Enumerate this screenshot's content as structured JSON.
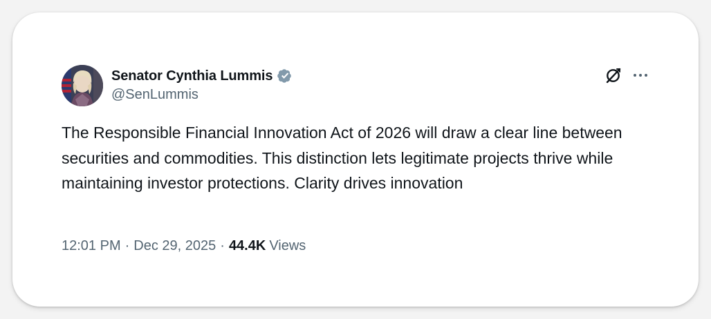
{
  "author": {
    "display_name": "Senator Cynthia Lummis",
    "handle": "@SenLummis",
    "verified": true,
    "verified_color": "#829aab",
    "avatar_icon": "profile-photo"
  },
  "actions": {
    "grok_icon": "grok-icon",
    "more_icon": "more-icon"
  },
  "tweet": {
    "text": "The Responsible Financial Innovation Act of 2026 will draw a clear line between securities and commodities. This distinction lets legitimate projects thrive while maintaining investor protections. Clarity drives innovation"
  },
  "meta": {
    "time": "12:01 PM",
    "separator": "·",
    "date": "Dec 29, 2025",
    "views_count": "44.4K",
    "views_label": "Views"
  },
  "colors": {
    "text_primary": "#0f1419",
    "text_secondary": "#536471",
    "card_background": "#ffffff",
    "page_background": "#f3f3f3"
  }
}
